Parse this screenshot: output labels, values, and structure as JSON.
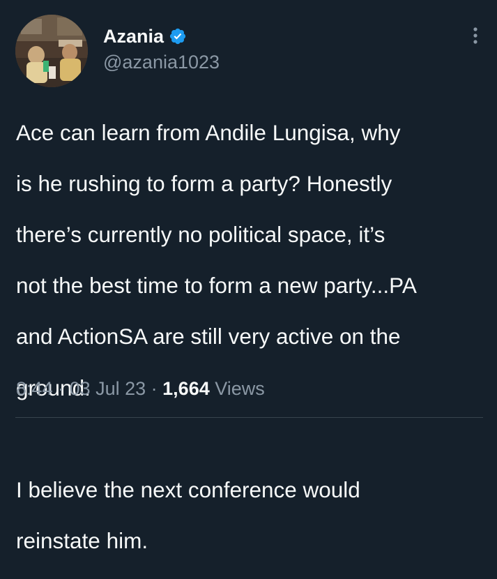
{
  "tweet": {
    "author": {
      "display_name": "Azania",
      "handle": "@azania1023",
      "verified": true,
      "verified_icon": "verified-badge-icon",
      "avatar": "profile-photo"
    },
    "text_line_1": "Ace can learn from Andile Lungisa, why",
    "text_line_2": "is he rushing to form a party? Honestly",
    "text_line_3": "there’s currently no political space, it’s",
    "text_line_4": "not the best time to form a new party...PA",
    "text_line_5": "and ActionSA are still very active on the",
    "text_line_6": "ground.",
    "text_line_7": "I believe the next conference would",
    "text_line_8": "reinstate him.",
    "time": "8:44",
    "separator": " · ",
    "date": "03 Jul 23",
    "views_count": "1,664",
    "views_label": "Views",
    "more_icon": "more-options-icon"
  },
  "colors": {
    "background": "#15202b",
    "text_primary": "#f7f9f9",
    "text_secondary": "#8b98a5",
    "verified_blue": "#1d9bf0",
    "divider": "#38444d"
  }
}
